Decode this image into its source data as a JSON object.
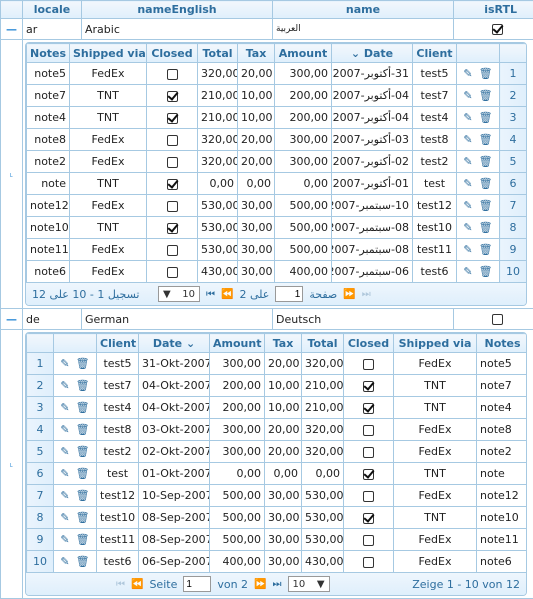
{
  "outer": {
    "headers": {
      "locale": "locale",
      "nameEnglish": "nameEnglish",
      "name": "name",
      "isRTL": "isRTL"
    },
    "rows": [
      {
        "locale": "ar",
        "nameEnglish": "Arabic",
        "name": "العربية",
        "isRTL": true,
        "expand_icon": "minus"
      },
      {
        "locale": "de",
        "nameEnglish": "German",
        "name": "Deutsch",
        "isRTL": false,
        "expand_icon": "minus"
      }
    ]
  },
  "ar_grid": {
    "headers": {
      "notes": "Notes",
      "shipped": "Shipped via",
      "closed": "Closed",
      "total": "Total",
      "tax": "Tax",
      "amount": "Amount",
      "date": "Date",
      "client": "Client"
    },
    "rows": [
      {
        "n": "1",
        "notes": "note5",
        "shipped": "FedEx",
        "closed": false,
        "total": "320,00",
        "tax": "20,00",
        "amount": "300,00",
        "date": "31-أكتوبر-2007",
        "client": "test5"
      },
      {
        "n": "2",
        "notes": "note7",
        "shipped": "TNT",
        "closed": true,
        "total": "210,00",
        "tax": "10,00",
        "amount": "200,00",
        "date": "04-أكتوبر-2007",
        "client": "test7"
      },
      {
        "n": "3",
        "notes": "note4",
        "shipped": "TNT",
        "closed": true,
        "total": "210,00",
        "tax": "10,00",
        "amount": "200,00",
        "date": "04-أكتوبر-2007",
        "client": "test4"
      },
      {
        "n": "4",
        "notes": "note8",
        "shipped": "FedEx",
        "closed": false,
        "total": "320,00",
        "tax": "20,00",
        "amount": "300,00",
        "date": "03-أكتوبر-2007",
        "client": "test8"
      },
      {
        "n": "5",
        "notes": "note2",
        "shipped": "FedEx",
        "closed": false,
        "total": "320,00",
        "tax": "20,00",
        "amount": "300,00",
        "date": "02-أكتوبر-2007",
        "client": "test2"
      },
      {
        "n": "6",
        "notes": "note",
        "shipped": "TNT",
        "closed": true,
        "total": "0,00",
        "tax": "0,00",
        "amount": "0,00",
        "date": "01-أكتوبر-2007",
        "client": "test"
      },
      {
        "n": "7",
        "notes": "note12",
        "shipped": "FedEx",
        "closed": false,
        "total": "530,00",
        "tax": "30,00",
        "amount": "500,00",
        "date": "10-سبتمبر-2007",
        "client": "test12"
      },
      {
        "n": "8",
        "notes": "note10",
        "shipped": "TNT",
        "closed": true,
        "total": "530,00",
        "tax": "30,00",
        "amount": "500,00",
        "date": "08-سبتمبر-2007",
        "client": "test10"
      },
      {
        "n": "9",
        "notes": "note11",
        "shipped": "FedEx",
        "closed": false,
        "total": "530,00",
        "tax": "30,00",
        "amount": "500,00",
        "date": "08-سبتمبر-2007",
        "client": "test11"
      },
      {
        "n": "10",
        "notes": "note6",
        "shipped": "FedEx",
        "closed": false,
        "total": "430,00",
        "tax": "30,00",
        "amount": "400,00",
        "date": "06-سبتمبر-2007",
        "client": "test6"
      }
    ],
    "pager": {
      "records": "تسجيل 1 - 10 على 12",
      "page_size": "10",
      "of_pages": "على 2",
      "page": "1",
      "page_label": "صفحة"
    }
  },
  "de_grid": {
    "headers": {
      "client": "Client",
      "date": "Date",
      "amount": "Amount",
      "tax": "Tax",
      "total": "Total",
      "closed": "Closed",
      "shipped": "Shipped via",
      "notes": "Notes"
    },
    "rows": [
      {
        "n": "1",
        "client": "test5",
        "date": "31-Okt-2007",
        "amount": "300,00",
        "tax": "20,00",
        "total": "320,00",
        "closed": false,
        "shipped": "FedEx",
        "notes": "note5"
      },
      {
        "n": "2",
        "client": "test7",
        "date": "04-Okt-2007",
        "amount": "200,00",
        "tax": "10,00",
        "total": "210,00",
        "closed": true,
        "shipped": "TNT",
        "notes": "note7"
      },
      {
        "n": "3",
        "client": "test4",
        "date": "04-Okt-2007",
        "amount": "200,00",
        "tax": "10,00",
        "total": "210,00",
        "closed": true,
        "shipped": "TNT",
        "notes": "note4"
      },
      {
        "n": "4",
        "client": "test8",
        "date": "03-Okt-2007",
        "amount": "300,00",
        "tax": "20,00",
        "total": "320,00",
        "closed": false,
        "shipped": "FedEx",
        "notes": "note8"
      },
      {
        "n": "5",
        "client": "test2",
        "date": "02-Okt-2007",
        "amount": "300,00",
        "tax": "20,00",
        "total": "320,00",
        "closed": false,
        "shipped": "FedEx",
        "notes": "note2"
      },
      {
        "n": "6",
        "client": "test",
        "date": "01-Okt-2007",
        "amount": "0,00",
        "tax": "0,00",
        "total": "0,00",
        "closed": true,
        "shipped": "TNT",
        "notes": "note"
      },
      {
        "n": "7",
        "client": "test12",
        "date": "10-Sep-2007",
        "amount": "500,00",
        "tax": "30,00",
        "total": "530,00",
        "closed": false,
        "shipped": "FedEx",
        "notes": "note12"
      },
      {
        "n": "8",
        "client": "test10",
        "date": "08-Sep-2007",
        "amount": "500,00",
        "tax": "30,00",
        "total": "530,00",
        "closed": true,
        "shipped": "TNT",
        "notes": "note10"
      },
      {
        "n": "9",
        "client": "test11",
        "date": "08-Sep-2007",
        "amount": "500,00",
        "tax": "30,00",
        "total": "530,00",
        "closed": false,
        "shipped": "FedEx",
        "notes": "note11"
      },
      {
        "n": "10",
        "client": "test6",
        "date": "06-Sep-2007",
        "amount": "400,00",
        "tax": "30,00",
        "total": "430,00",
        "closed": false,
        "shipped": "FedEx",
        "notes": "note6"
      }
    ],
    "pager": {
      "page_label": "Seite",
      "page": "1",
      "of_pages": "von 2",
      "page_size": "10",
      "records": "Zeige 1 - 10 von 12"
    }
  },
  "colors": {
    "header_text": "#2e6e9e",
    "border": "#a6c9e2",
    "header_bg": "#dfeffc"
  }
}
